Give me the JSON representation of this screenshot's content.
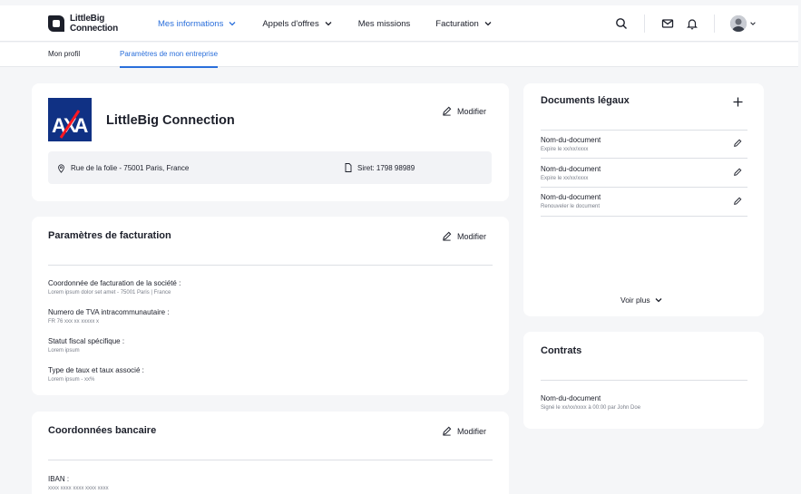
{
  "brand": {
    "line1": "LittleBig",
    "line2": "Connection"
  },
  "nav": {
    "items": [
      {
        "label": "Mes informations",
        "active": true,
        "dropdown": true
      },
      {
        "label": "Appels d'offres",
        "active": false,
        "dropdown": true
      },
      {
        "label": "Mes missions",
        "active": false,
        "dropdown": false
      },
      {
        "label": "Facturation",
        "active": false,
        "dropdown": true
      }
    ],
    "icons": [
      "search-icon",
      "mail-icon",
      "bell-icon"
    ]
  },
  "subnav": {
    "tabs": [
      {
        "label": "Mon profil",
        "active": false
      },
      {
        "label": "Paramètres de mon entreprise",
        "active": true
      }
    ]
  },
  "company": {
    "logo_text": "AXA",
    "name": "LittleBig Connection",
    "modify_label": "Modifier",
    "address": "Rue de la folie - 75001 Paris, France",
    "siret": "Siret: 1798 98989"
  },
  "billing": {
    "title": "Paramètres de facturation",
    "modify_label": "Modifier",
    "fields": [
      {
        "label": "Coordonnée de facturation de la société :",
        "value": "Lorem ipsum dolor set amet - 75001 Paris | France"
      },
      {
        "label": "Numero de TVA intracommunautaire :",
        "value": "FR 76 xxx xx xxxxx x"
      },
      {
        "label": "Statut fiscal spécifique :",
        "value": "Lorem ipsum"
      },
      {
        "label": "Type de taux et taux associé :",
        "value": "Lorem ipsum - xx%"
      }
    ]
  },
  "bank": {
    "title": "Coordonnées bancaire",
    "modify_label": "Modifier",
    "fields": [
      {
        "label": "IBAN :",
        "value": "xxxx xxxx xxxx xxxx xxxx"
      }
    ]
  },
  "legal_docs": {
    "title": "Documents légaux",
    "items": [
      {
        "name": "Nom-du-document",
        "sub": "Expire le xx/xx/xxxx"
      },
      {
        "name": "Nom-du-document",
        "sub": "Expire le xx/xx/xxxx"
      },
      {
        "name": "Nom-du-document",
        "sub": "Renouveler le document"
      }
    ],
    "more_label": "Voir plus"
  },
  "contracts": {
    "title": "Contrats",
    "items": [
      {
        "name": "Nom-du-document",
        "sub": "Signé le xx/xx/xxxx à 00:00 par John Doe"
      }
    ]
  },
  "colors": {
    "accent": "#2a6fdb",
    "axa_blue": "#103184",
    "axa_red": "#ff1721"
  }
}
